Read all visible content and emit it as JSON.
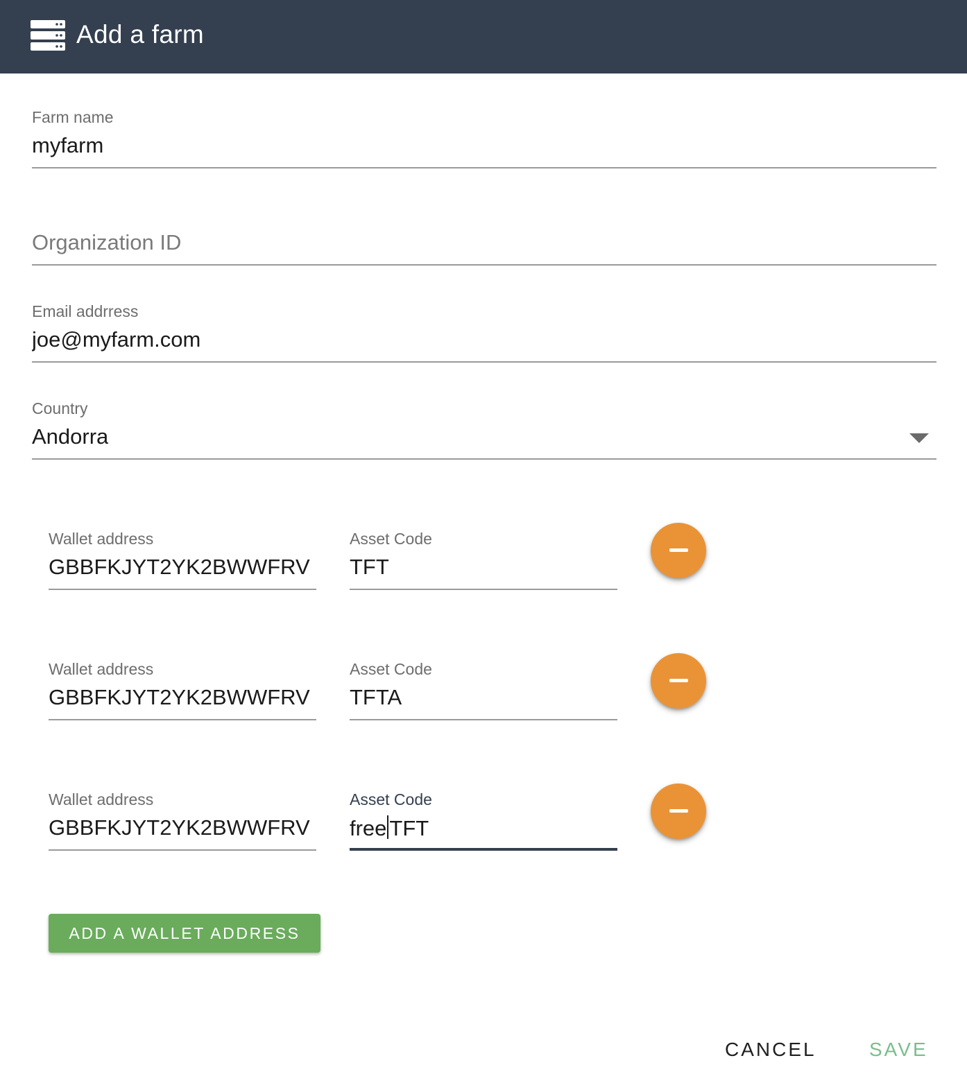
{
  "header": {
    "title": "Add a farm",
    "icon": "server-icon",
    "background": "#34404f"
  },
  "form": {
    "farm_name": {
      "label": "Farm name",
      "value": "myfarm"
    },
    "organization_id": {
      "placeholder": "Organization ID",
      "value": ""
    },
    "email": {
      "label": "Email addrress",
      "value": "joe@myfarm.com"
    },
    "country": {
      "label": "Country",
      "value": "Andorra",
      "icon": "dropdown-arrow-icon"
    }
  },
  "wallets": [
    {
      "address_label": "Wallet address",
      "address": "GBBFKJYT2YK2BWWFRV",
      "asset_label": "Asset Code",
      "asset": "TFT"
    },
    {
      "address_label": "Wallet address",
      "address": "GBBFKJYT2YK2BWWFRV",
      "asset_label": "Asset Code",
      "asset": "TFTA"
    },
    {
      "address_label": "Wallet address",
      "address": "GBBFKJYT2YK2BWWFRV",
      "asset_label": "Asset Code",
      "asset_before_caret": "free",
      "asset_after_caret": "TFT",
      "focused": true
    }
  ],
  "buttons": {
    "add_wallet": "ADD A WALLET ADDRESS",
    "cancel": "CANCEL",
    "save": "SAVE",
    "remove_icon": "minus-icon"
  },
  "colors": {
    "accent_orange": "#ea9336",
    "accent_green": "#6aac5c",
    "save_text": "#79be8c"
  }
}
